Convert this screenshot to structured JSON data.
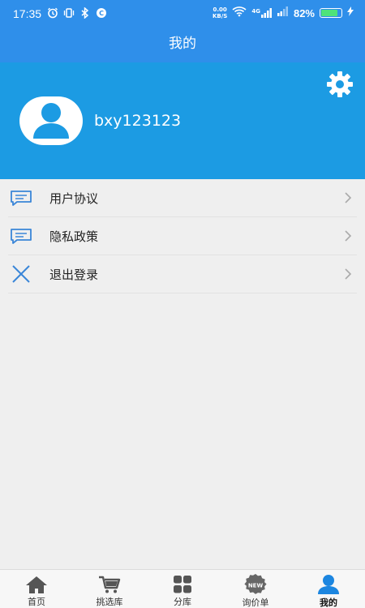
{
  "status_bar": {
    "time": "17:35",
    "net_speed_value": "0.00",
    "net_speed_unit": "KB/S",
    "network": "4G",
    "battery_percent": "82%",
    "battery_level": 0.82
  },
  "header": {
    "title": "我的"
  },
  "profile": {
    "username": "bxy123123",
    "settings_icon": "gear-icon",
    "avatar_icon": "user-avatar-icon"
  },
  "menu": {
    "items": [
      {
        "label": "用户协议",
        "icon": "message-icon"
      },
      {
        "label": "隐私政策",
        "icon": "message-icon"
      },
      {
        "label": "退出登录",
        "icon": "close-icon"
      }
    ]
  },
  "tab_bar": {
    "tabs": [
      {
        "label": "首页",
        "icon": "home-icon"
      },
      {
        "label": "挑选库",
        "icon": "cart-icon"
      },
      {
        "label": "分库",
        "icon": "grid-icon"
      },
      {
        "label": "询价单",
        "icon": "new-badge-icon",
        "badge": "NEW"
      },
      {
        "label": "我的",
        "icon": "user-icon",
        "active": true
      }
    ]
  },
  "colors": {
    "header_blue": "#2f8fea",
    "profile_blue": "#1c9be3",
    "icon_blue": "#3a86d8",
    "background": "#efefef"
  }
}
